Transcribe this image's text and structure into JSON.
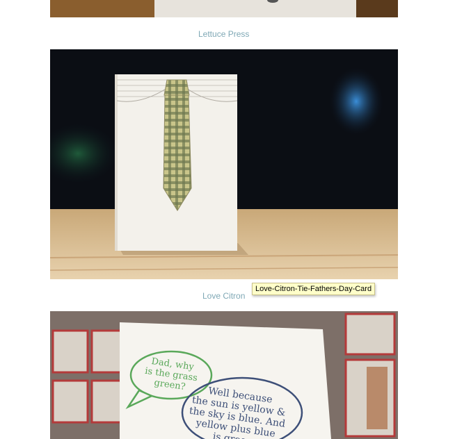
{
  "gallery": {
    "items": [
      {
        "caption": "Lettuce Press"
      },
      {
        "caption": "Love Citron",
        "tooltip": "Love-Citron-Tie-Fathers-Day-Card"
      }
    ],
    "partial_card": {
      "bubble_green_lines": [
        "Dad, why",
        "is the grass",
        "green?"
      ],
      "bubble_blue_lines": [
        "Well because",
        "the sun is yellow &",
        "the sky is blue. And",
        "yellow plus blue",
        "is green."
      ]
    }
  },
  "colors": {
    "caption": "#7fa8b5",
    "tooltip_bg": "#ffffc9",
    "bubble_green": "#5aa85a",
    "bubble_blue": "#3d4f78"
  }
}
